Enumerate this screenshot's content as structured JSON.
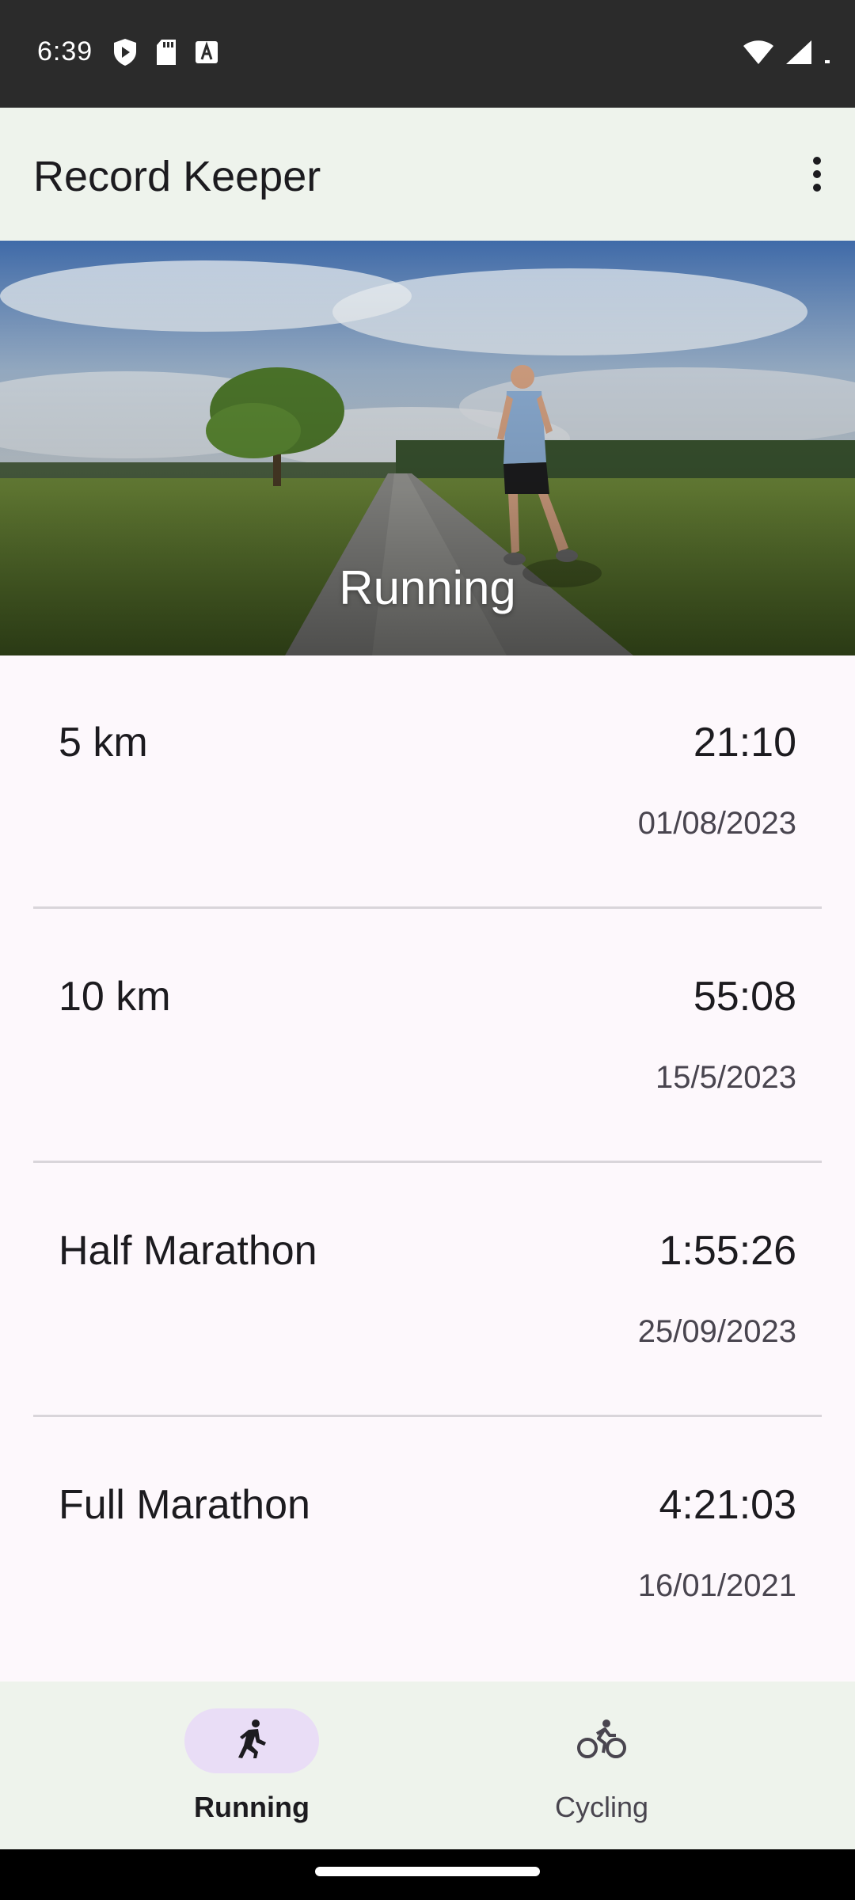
{
  "status_bar": {
    "time": "6:39",
    "icons_left": [
      "shield-icon",
      "sd-card-icon",
      "font-a-icon"
    ],
    "icons_right": [
      "wifi-icon",
      "cellular-signal-icon"
    ]
  },
  "app_bar": {
    "title": "Record Keeper",
    "menu_icon": "more-vert-icon"
  },
  "hero": {
    "title": "Running"
  },
  "records": [
    {
      "event": "5 km",
      "time": "21:10",
      "date": "01/08/2023"
    },
    {
      "event": "10 km",
      "time": "55:08",
      "date": "15/5/2023"
    },
    {
      "event": "Half Marathon",
      "time": "1:55:26",
      "date": "25/09/2023"
    },
    {
      "event": "Full Marathon",
      "time": "4:21:03",
      "date": "16/01/2021"
    }
  ],
  "bottom_nav": {
    "items": [
      {
        "label": "Running",
        "icon": "running-icon",
        "active": true
      },
      {
        "label": "Cycling",
        "icon": "cycling-icon",
        "active": false
      }
    ]
  },
  "colors": {
    "app_bar_bg": "#eef3ec",
    "content_bg": "#fdf8fc",
    "active_pill": "#e9ddf6",
    "status_bar_bg": "#2b2b2b"
  }
}
